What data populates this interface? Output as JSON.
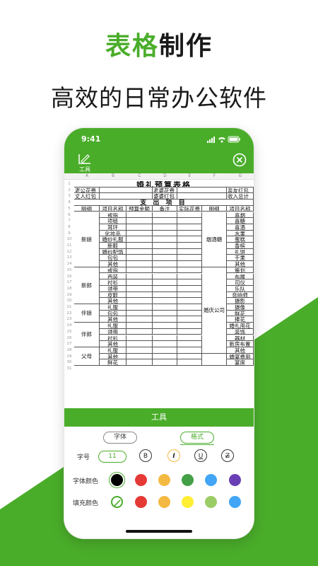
{
  "promo": {
    "title_green": "表格",
    "title_dark": "制作",
    "subtitle": "高效的日常办公软件"
  },
  "status": {
    "time": "9:41"
  },
  "toolbar": {
    "tool_label": "工具"
  },
  "sheet": {
    "columns": [
      "A",
      "B",
      "C",
      "D",
      "E",
      "F",
      "G"
    ],
    "title": "婚礼预算表格",
    "row2": {
      "a": "老公花费",
      "c": "老婆花费",
      "e": "亲友红包"
    },
    "row3": {
      "a": "丈人红包",
      "c": "婆婆红包",
      "e": "收入总计"
    },
    "section": "支 出 项 目",
    "headers": [
      "明细",
      "项目名称",
      "预算金额",
      "备注",
      "实际花费",
      "明细",
      "项目名称"
    ],
    "left_groups": [
      {
        "name": "新娘",
        "items": [
          "戒指",
          "项链",
          "耳环",
          "化妆品",
          "婚纱礼服",
          "新鞋",
          "婚纱配饰",
          "包包",
          "其他"
        ]
      },
      {
        "name": "新郎",
        "items": [
          "戒指",
          "西装",
          "衬衫",
          "领带",
          "皮鞋",
          "其他"
        ]
      },
      {
        "name": "伴娘",
        "items": [
          "礼服",
          "包包",
          "其他"
        ]
      },
      {
        "name": "伴郎",
        "items": [
          "礼服",
          "领带",
          "衬衫",
          "其他"
        ]
      },
      {
        "name": "父母",
        "items": [
          "礼服",
          "其他",
          "鲜花"
        ]
      }
    ],
    "right_groups": [
      {
        "name": "烟酒糖",
        "items": [
          "喜烟",
          "喜糖",
          "喜酒",
          "水果",
          "蛋糕",
          "香槟",
          "礼饼",
          "干果",
          "其他"
        ]
      },
      {
        "name": "婚庆公司",
        "items": [
          "策划",
          "布展",
          "司仪",
          "乐队",
          "音响师",
          "摄影",
          "摄像",
          "鲜花",
          "捧花",
          "婚礼用花",
          "装饰",
          "器材",
          "新房布置",
          "其他"
        ]
      },
      {
        "name": "",
        "items": [
          "婚宴费用",
          "宴席"
        ]
      }
    ],
    "row_numbers": [
      "1",
      "2",
      "3",
      "4",
      "5",
      "6",
      "7",
      "8",
      "9",
      "10",
      "11",
      "12",
      "13",
      "14",
      "15",
      "16",
      "17",
      "18",
      "19",
      "20",
      "21",
      "22",
      "23",
      "24",
      "25",
      "26",
      "27",
      "28",
      "29",
      "30",
      "31"
    ]
  },
  "panel": {
    "title": "工具",
    "tabs": [
      "字体",
      "格式"
    ],
    "active_tab": "格式",
    "font_size_label": "字号",
    "font_size_value": "11",
    "format_buttons": [
      {
        "label": "B",
        "name": "bold-button"
      },
      {
        "label": "I",
        "name": "italic-button"
      },
      {
        "label": "U",
        "name": "underline-button"
      },
      {
        "label": "Z",
        "name": "strikethrough-button"
      }
    ],
    "font_color_label": "字体颜色",
    "font_colors": [
      "#000000",
      "#e53935",
      "#f4b942",
      "#43a047",
      "#42a5f5",
      "#6a3fb5"
    ],
    "fill_color_label": "填充颜色",
    "fill_colors": [
      "none",
      "#e53935",
      "#f4b942",
      "#ffee33",
      "#9ccc65",
      "#42a5f5"
    ]
  }
}
